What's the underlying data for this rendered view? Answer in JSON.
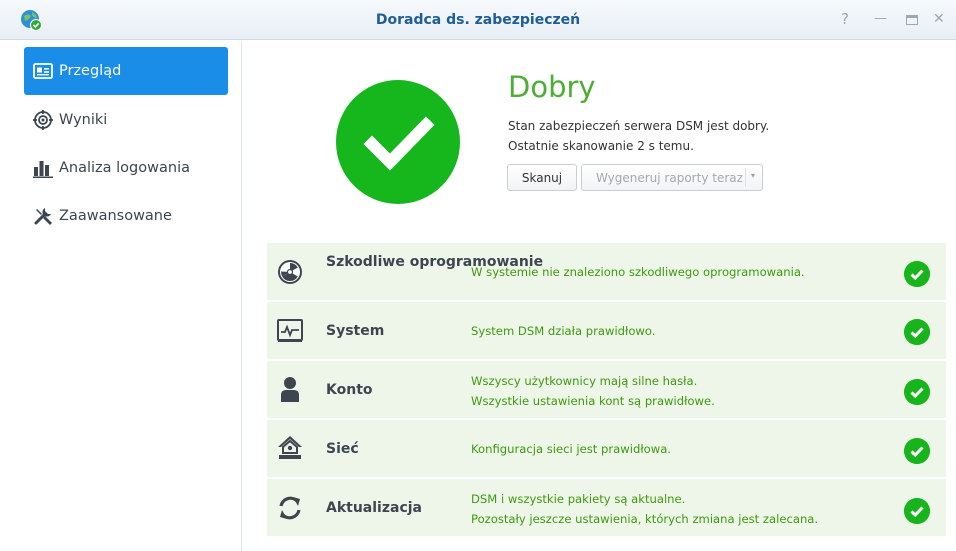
{
  "window": {
    "title": "Doradca ds. zabezpieczeń",
    "controls": [
      "help-icon",
      "minimize-icon",
      "maximize-icon",
      "close-icon"
    ],
    "help_glyph": "?",
    "minimize_glyph": "—",
    "close_glyph": "✕"
  },
  "sidebar": {
    "items": [
      {
        "label": "Przegląd",
        "icon": "overview-icon",
        "active": true
      },
      {
        "label": "Wyniki",
        "icon": "target-icon",
        "active": false
      },
      {
        "label": "Analiza logowania",
        "icon": "bar-chart-icon",
        "active": false
      },
      {
        "label": "Zaawansowane",
        "icon": "tools-icon",
        "active": false
      }
    ]
  },
  "summary": {
    "status": "Dobry",
    "description": "Stan zabezpieczeń serwera DSM jest dobry.",
    "last_scan": "Ostatnie skanowanie 2 s temu.",
    "scan_button": "Skanuj",
    "report_button": "Wygeneruj raporty teraz",
    "report_caret": "▾"
  },
  "results": [
    {
      "title": "Szkodliwe oprogramowanie",
      "icon": "radiation-icon",
      "messages": [
        "W systemie nie znaleziono szkodliwego oprogramowania."
      ],
      "status": "ok"
    },
    {
      "title": "System",
      "icon": "system-monitor-icon",
      "messages": [
        "System DSM działa prawidłowo."
      ],
      "status": "ok"
    },
    {
      "title": "Konto",
      "icon": "user-icon",
      "messages": [
        "Wszyscy użytkownicy mają silne hasła.",
        "Wszystkie ustawienia kont są prawidłowe."
      ],
      "status": "ok"
    },
    {
      "title": "Sieć",
      "icon": "network-home-icon",
      "messages": [
        "Konfiguracja sieci jest prawidłowa."
      ],
      "status": "ok"
    },
    {
      "title": "Aktualizacja",
      "icon": "update-icon",
      "messages": [
        "DSM i wszystkie pakiety są aktualne.",
        "Pozostały jeszcze ustawienia, których zmiana jest zalecana."
      ],
      "status": "ok"
    }
  ],
  "colors": {
    "accent": "#1a8de8",
    "good": "#16b61d",
    "good_text": "#3e9b0e",
    "row_bg": "#eef6ea",
    "title_text": "#1d5d98"
  }
}
